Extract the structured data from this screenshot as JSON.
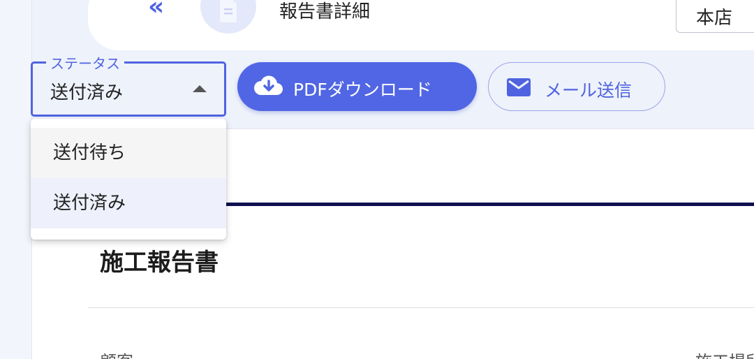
{
  "header": {
    "title": "報告書詳細",
    "store": "本店",
    "back_icon": "chevrons-left-icon",
    "avatar_icon": "document-icon"
  },
  "toolbar": {
    "status_label": "ステータス",
    "status_value": "送付済み",
    "pdf_label": "PDFダウンロード",
    "mail_label": "メール送信"
  },
  "dropdown": {
    "options": [
      "送付待ち",
      "送付済み"
    ],
    "selected": "送付済み"
  },
  "report": {
    "title": "施工報告書",
    "customer_label": "顧客",
    "site_label": "施工場所"
  },
  "colors": {
    "accent": "#5166e4",
    "navy": "#0d1150",
    "background": "#eef2fb"
  }
}
